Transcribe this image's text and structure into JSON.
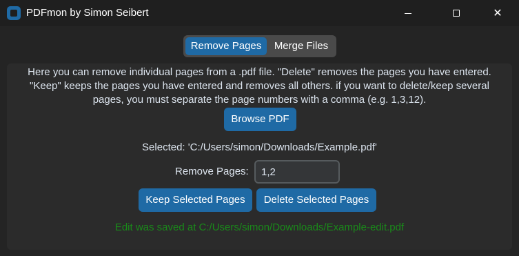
{
  "window": {
    "title": "PDFmon by Simon Seibert",
    "icon": "app-logo-icon",
    "controls": {
      "minimize": "minimize-icon",
      "maximize": "maximize-icon",
      "close": "✕"
    }
  },
  "tabs": [
    {
      "label": "Remove Pages",
      "selected": true
    },
    {
      "label": "Merge Files",
      "selected": false
    }
  ],
  "remove_pages": {
    "description": "Here you can remove individual pages from a .pdf file. \"Delete\" removes the pages you have entered. \"Keep\" keeps the pages you have entered and removes all others. if you want to delete/keep several pages, you must separate the page numbers with a comma (e.g. 1,3,12).",
    "browse_label": "Browse PDF",
    "selected_text": "Selected: 'C:/Users/simon/Downloads/Example.pdf'",
    "pages_label": "Remove Pages:",
    "pages_value": "1,2",
    "keep_label": "Keep Selected Pages",
    "delete_label": "Delete Selected Pages",
    "status_text": "Edit was saved at C:/Users/simon/Downloads/Example-edit.pdf"
  },
  "colors": {
    "accent": "#1f6aa5",
    "status_success": "#1a8a1a",
    "background": "#242424",
    "panel": "#2b2b2b"
  }
}
